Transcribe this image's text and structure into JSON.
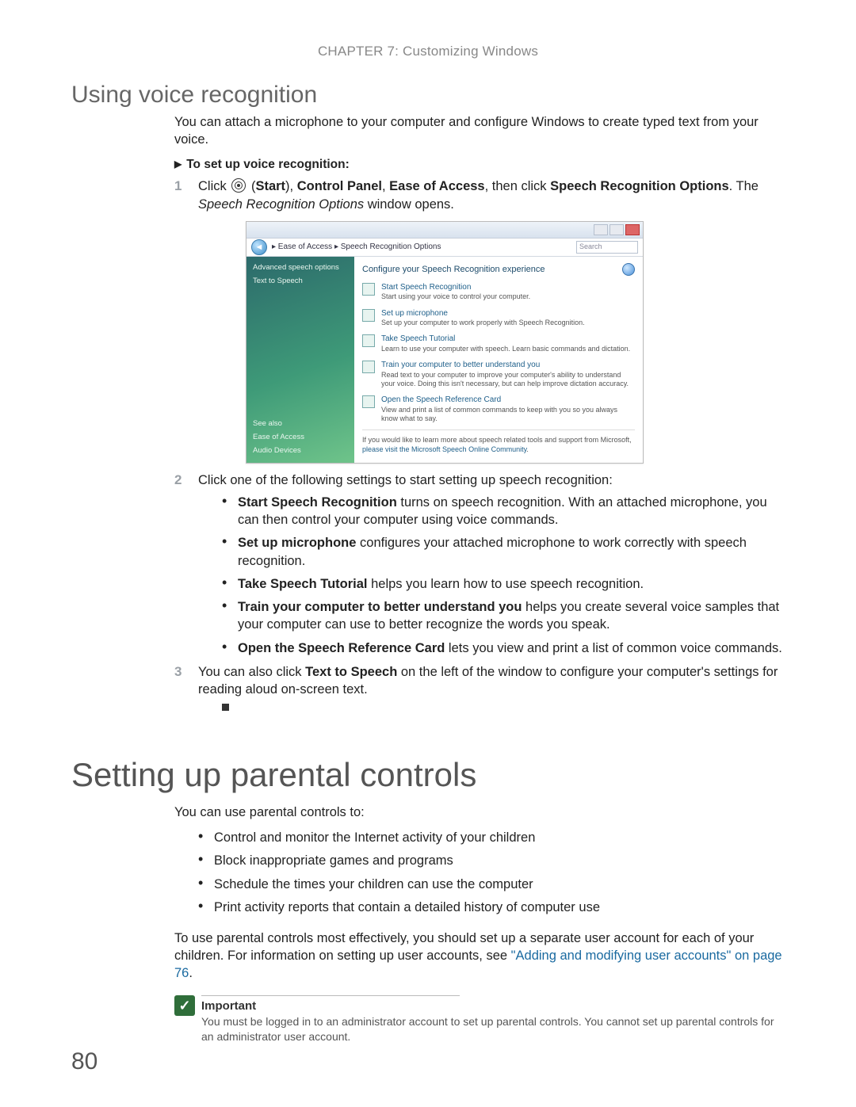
{
  "chapter": "CHAPTER 7: Customizing Windows",
  "voice": {
    "heading": "Using voice recognition",
    "intro": "You can attach a microphone to your computer and configure Windows to create typed text from your voice.",
    "task_heading": "To set up voice recognition:",
    "step1_prefix": "Click ",
    "step1_start_paren_open": "(",
    "step1_start": "Start",
    "step1_paren_close": ")",
    "step1_sep": ", ",
    "step1_cp": "Control Panel",
    "step1_eoa": "Ease of Access",
    "step1_then": ", then click ",
    "step1_sro": "Speech Recognition Options",
    "step1_dot": ". The ",
    "step1_win": "Speech Recognition Options",
    "step1_end": " window opens.",
    "step2": "Click one of the following settings to start setting up speech recognition:",
    "b1_b": "Start Speech Recognition",
    "b1_t": " turns on speech recognition. With an attached microphone, you can then control your computer using voice commands.",
    "b2_b": "Set up microphone",
    "b2_t": " configures your attached microphone to work correctly with speech recognition.",
    "b3_b": "Take Speech Tutorial",
    "b3_t": " helps you learn how to use speech recognition.",
    "b4_b": "Train your computer to better understand you",
    "b4_t": " helps you create several voice samples that your computer can use to better recognize the words you speak.",
    "b5_b": "Open the Speech Reference Card",
    "b5_t": " lets you view and print a list of common voice commands.",
    "step3_pre": "You can also click ",
    "step3_b": "Text to Speech",
    "step3_post": " on the left of the window to configure your computer's settings for reading aloud on-screen text."
  },
  "parental": {
    "heading": "Setting up parental controls",
    "intro": "You can use parental controls to:",
    "p1": "Control and monitor the Internet activity of your children",
    "p2": "Block inappropriate games and programs",
    "p3": "Schedule the times your children can use the computer",
    "p4": "Print activity reports that contain a detailed history of computer use",
    "para_pre": "To use parental controls most effectively, you should set up a separate user account for each of your children. For information on setting up user accounts, see ",
    "para_link": "\"Adding and modifying user accounts\" on page 76",
    "para_post": ".",
    "imp_title": "Important",
    "imp_body": "You must be logged in to an administrator account to set up parental controls. You cannot set up parental controls for an administrator user account."
  },
  "screenshot": {
    "breadcrumb": "▸ Ease of Access ▸ Speech Recognition Options",
    "search": "Search",
    "side_top1": "Advanced speech options",
    "side_top2": "Text to Speech",
    "side_see": "See also",
    "side_s1": "Ease of Access",
    "side_s2": "Audio Devices",
    "main_hdr": "Configure your Speech Recognition experience",
    "i1t": "Start Speech Recognition",
    "i1d": "Start using your voice to control your computer.",
    "i2t": "Set up microphone",
    "i2d": "Set up your computer to work properly with Speech Recognition.",
    "i3t": "Take Speech Tutorial",
    "i3d": "Learn to use your computer with speech. Learn basic commands and dictation.",
    "i4t": "Train your computer to better understand you",
    "i4d": "Read text to your computer to improve your computer's ability to understand your voice. Doing this isn't necessary, but can help improve dictation accuracy.",
    "i5t": "Open the Speech Reference Card",
    "i5d": "View and print a list of common commands to keep with you so you always know what to say.",
    "foot_pre": "If you would like to learn more about speech related tools and support from Microsoft, ",
    "foot_link": "please visit the Microsoft Speech Online Community"
  },
  "page_number": "80"
}
